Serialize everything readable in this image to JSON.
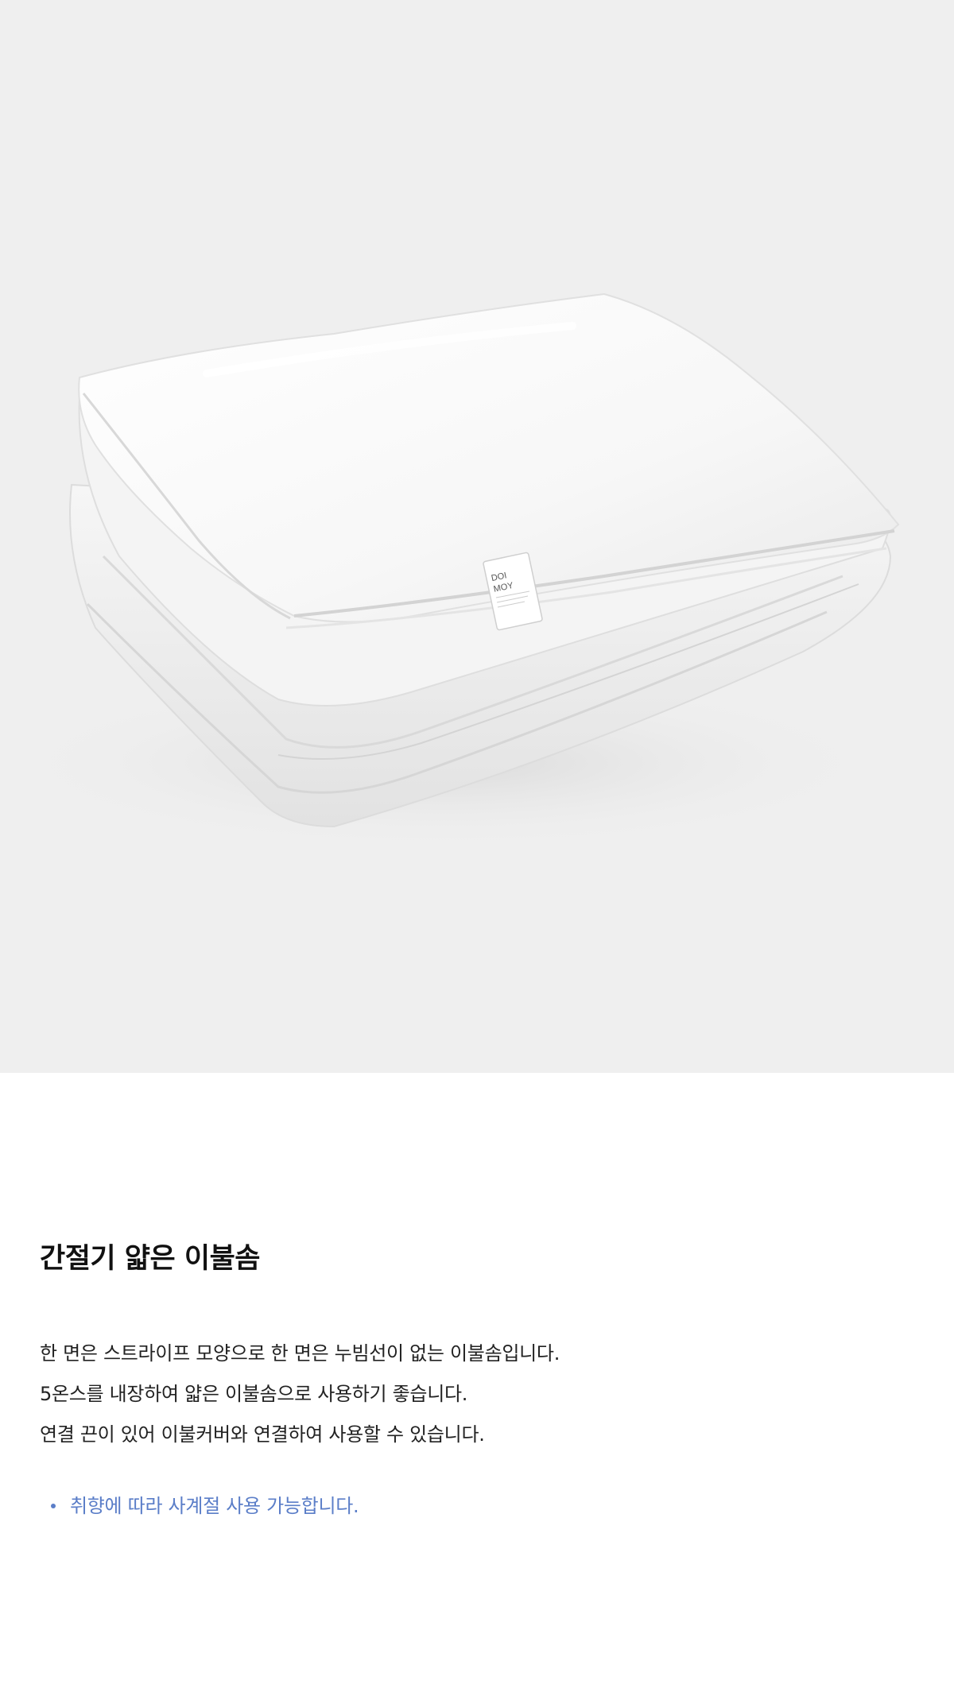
{
  "hero": {
    "image_alt": "흰색 이불솜이 접혀 있는 제품 사진",
    "label": {
      "line1": "DOI",
      "line2": "MOY"
    },
    "background_color": "#efefef"
  },
  "product": {
    "title": "간절기 얇은 이불솜",
    "description": [
      "한 면은 스트라이프 모양으로 한 면은 누빔선이 없는 이불솜입니다.",
      "5온스를 내장하여 얇은 이불솜으로 사용하기 좋습니다.",
      "연결 끈이 있어 이불커버와 연결하여 사용할 수 있습니다."
    ],
    "notes": [
      "취향에 따라 사계절 사용 가능합니다."
    ],
    "accent_color": "#5b7ec8"
  }
}
